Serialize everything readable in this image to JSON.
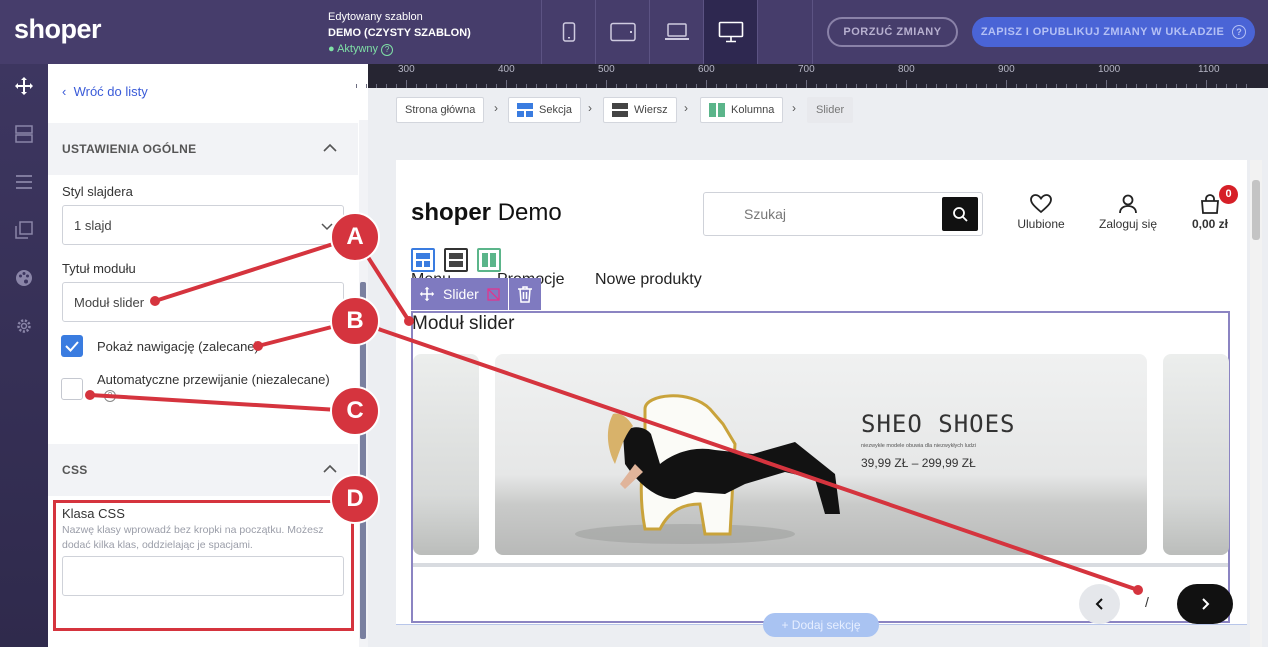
{
  "topbar": {
    "logo": "shoper",
    "template_caption": "Edytowany szablon",
    "template_name": "DEMO (CZYSTY SZABLON)",
    "template_status": "Aktywny",
    "discard_label": "PORZUĆ ZMIANY",
    "publish_label": "ZAPISZ I OPUBLIKUJ ZMIANY W UKŁADZIE",
    "devices": [
      "mobile-icon",
      "tablet-icon",
      "laptop-icon",
      "desktop-icon"
    ]
  },
  "panel": {
    "back_label": "Wróć do listy",
    "section_general": "USTAWIENIA OGÓLNE",
    "slider_style_label": "Styl slajdera",
    "slider_style_value": "1 slajd",
    "module_title_label": "Tytuł modułu",
    "module_title_value": "Moduł slider",
    "show_nav_label": "Pokaż nawigację (zalecane)",
    "show_nav_checked": true,
    "autoplay_label": "Automatyczne przewijanie (niezalecane)",
    "autoplay_checked": false,
    "section_css": "CSS",
    "css_class_label": "Klasa CSS",
    "css_class_help": "Nazwę klasy wprowadź bez kropki na początku. Możesz dodać kilka klas, oddzielając je spacjami.",
    "css_class_value": ""
  },
  "ruler": {
    "ticks": [
      "300",
      "400",
      "500",
      "600",
      "700",
      "800",
      "900",
      "1000",
      "1100"
    ]
  },
  "breadcrumb": {
    "items": [
      "Strona główna",
      "Sekcja",
      "Wiersz",
      "Kolumna",
      "Slider"
    ]
  },
  "store": {
    "logo_bold": "shoper",
    "logo_regular": "Demo",
    "search_placeholder": "Szukaj",
    "favorites_label": "Ulubione",
    "login_label": "Zaloguj się",
    "cart_total": "0,00 zł",
    "cart_count": "0",
    "menu": [
      "Menu",
      "Promocje",
      "Nowe produkty"
    ]
  },
  "slider_module": {
    "toolbar_label": "Slider",
    "title": "Moduł slider",
    "slide_heading": "SHEO SHOES",
    "slide_subtext": "niezwykłe modele obuwia dla niezwykłych ludzi",
    "slide_price": "39,99 ZŁ – 299,99 ZŁ",
    "pager_separator": "/",
    "add_section_label": "+ Dodaj sekcję"
  },
  "callouts": [
    "A",
    "B",
    "C",
    "D"
  ],
  "colors": {
    "topbar": "#463d6b",
    "accent_blue": "#4a64d6",
    "callout_red": "#d5343e",
    "slider_border": "#8b84c2"
  }
}
